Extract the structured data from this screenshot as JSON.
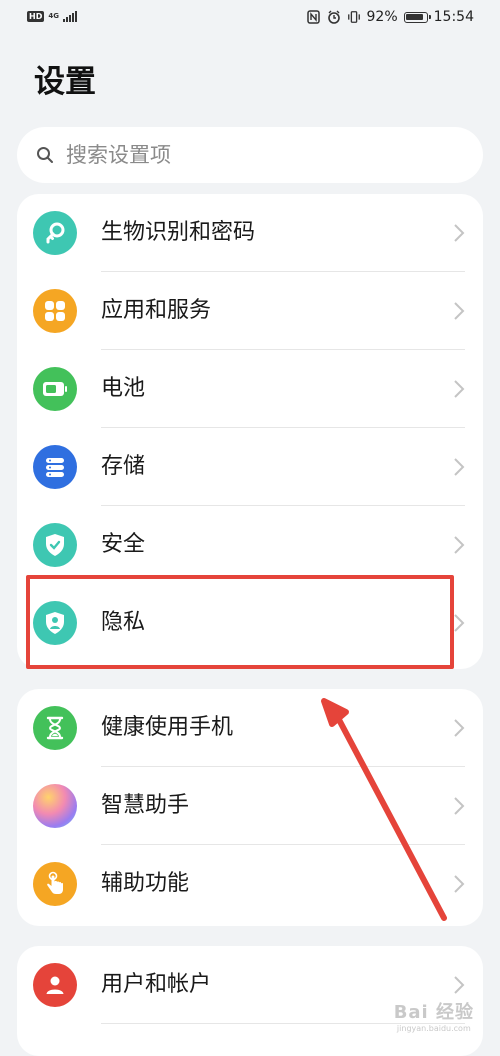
{
  "status_bar": {
    "hd": "HD",
    "network": "4G",
    "battery_percent": "92%",
    "time": "15:54"
  },
  "header": {
    "title": "设置"
  },
  "search": {
    "placeholder": "搜索设置项"
  },
  "groups": [
    {
      "items": [
        {
          "label": "生物识别和密码",
          "icon": "key-icon",
          "color": "#3ec7b2"
        },
        {
          "label": "应用和服务",
          "icon": "apps-grid-icon",
          "color": "#f5a623"
        },
        {
          "label": "电池",
          "icon": "battery-icon",
          "color": "#43c15a"
        },
        {
          "label": "存储",
          "icon": "storage-icon",
          "color": "#2f6fe0"
        },
        {
          "label": "安全",
          "icon": "shield-check-icon",
          "color": "#3ec7b2"
        },
        {
          "label": "隐私",
          "icon": "privacy-shield-icon",
          "color": "#3ec7b2"
        }
      ]
    },
    {
      "items": [
        {
          "label": "健康使用手机",
          "icon": "hourglass-icon",
          "color": "#43c15a"
        },
        {
          "label": "智慧助手",
          "icon": "assistant-orb-icon",
          "color": "#b57bdc"
        },
        {
          "label": "辅助功能",
          "icon": "hand-pointer-icon",
          "color": "#f5a623"
        }
      ]
    },
    {
      "items": [
        {
          "label": "用户和帐户",
          "icon": "user-icon",
          "color": "#e5443a"
        }
      ]
    }
  ],
  "annotation": {
    "highlight_color": "#e5443a"
  },
  "watermark": {
    "main": "Bai 经验",
    "sub": "jingyan.baidu.com"
  }
}
